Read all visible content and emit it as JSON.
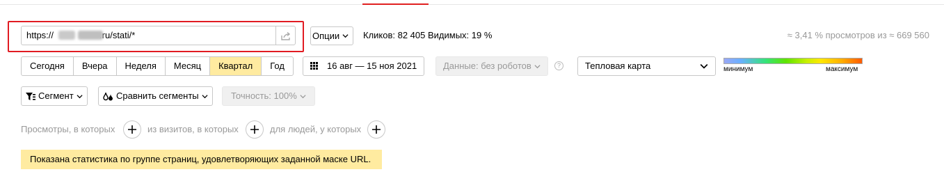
{
  "url_filter": {
    "prefix": "https://",
    "suffix": ".ru/stati/*"
  },
  "options_label": "Опции",
  "stats": {
    "clicks": "Кликов: 82 405",
    "visible": "Видимых: 19 %",
    "views": "≈ 3,41 % просмотров из ≈ 669 560"
  },
  "periods": [
    "Сегодня",
    "Вчера",
    "Неделя",
    "Месяц",
    "Квартал",
    "Год"
  ],
  "active_period": "Квартал",
  "date_range": "16 авг — 15 ноя 2021",
  "data_filter": "Данные: без роботов",
  "heatmap_select": "Тепловая карта",
  "legend": {
    "min": "минимум",
    "max": "максимум"
  },
  "segment_label": "Сегмент",
  "compare_label": "Сравнить сегменты",
  "accuracy_label": "Точность: 100%",
  "conditions": {
    "views": "Просмотры, в которых",
    "visits": "из визитов, в которых",
    "people": "для людей, у которых"
  },
  "notice": "Показана статистика по группе страниц, удовлетворяющих заданной маске URL.",
  "colors": {
    "accent_red": "#e11b22",
    "active_period_bg": "#ffeba0",
    "notice_bg": "#ffeba0"
  }
}
